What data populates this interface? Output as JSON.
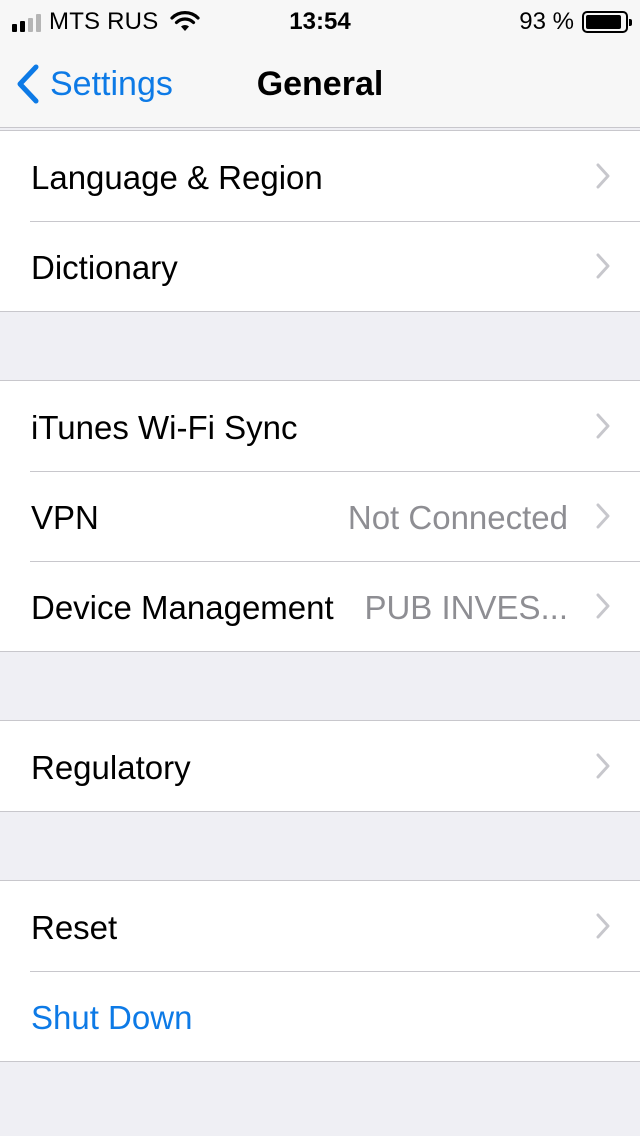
{
  "status_bar": {
    "carrier": "MTS RUS",
    "time": "13:54",
    "battery_percent": "93 %",
    "battery_level": 0.93,
    "signal_bars": 4,
    "signal_bars_filled": 2,
    "icons": [
      "signal-icon",
      "wifi-icon",
      "battery-icon"
    ]
  },
  "nav": {
    "back_label": "Settings",
    "title": "General",
    "back_icon": "chevron-left-icon"
  },
  "groups": [
    {
      "rows": [
        {
          "label": "Language & Region"
        },
        {
          "label": "Dictionary"
        }
      ]
    },
    {
      "rows": [
        {
          "label": "iTunes Wi-Fi Sync"
        },
        {
          "label": "VPN",
          "value": "Not Connected"
        },
        {
          "label": "Device Management",
          "value": "PUB INVES..."
        }
      ]
    },
    {
      "rows": [
        {
          "label": "Regulatory"
        }
      ]
    },
    {
      "rows": [
        {
          "label": "Reset"
        },
        {
          "label": "Shut Down"
        }
      ]
    }
  ],
  "colors": {
    "accent": "#0d7ae6",
    "background": "#efeff4",
    "separator": "#c8c7cc",
    "secondary_text": "#8e8e93",
    "chevron": "#c7c7cc"
  }
}
